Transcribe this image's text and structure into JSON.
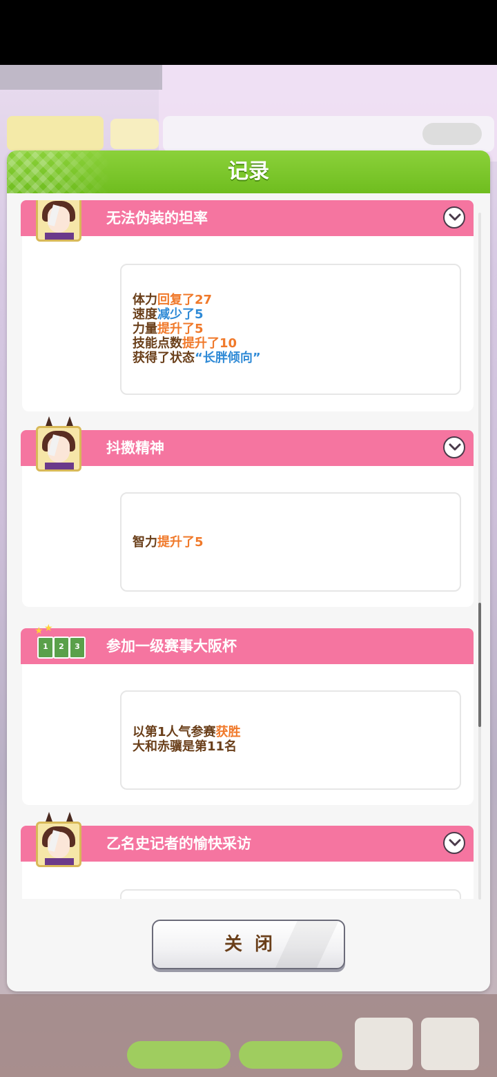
{
  "dialog": {
    "title": "记录"
  },
  "entries": [
    {
      "title": "无法伪装的坦率",
      "icon": "character-avatar",
      "lines": [
        {
          "parts": [
            {
              "text": "体力",
              "color": "brown"
            },
            {
              "text": "回复了27",
              "color": "orange"
            }
          ]
        },
        {
          "parts": [
            {
              "text": "速度",
              "color": "brown"
            },
            {
              "text": "减少了5",
              "color": "blue"
            }
          ]
        },
        {
          "parts": [
            {
              "text": "力量",
              "color": "brown"
            },
            {
              "text": "提升了5",
              "color": "orange"
            }
          ]
        },
        {
          "parts": [
            {
              "text": "技能点数",
              "color": "brown"
            },
            {
              "text": "提升了10",
              "color": "orange"
            }
          ]
        },
        {
          "parts": [
            {
              "text": "获得了状态",
              "color": "brown"
            },
            {
              "text": "“长胖倾向”",
              "color": "blue"
            }
          ]
        }
      ]
    },
    {
      "title": "抖擞精神",
      "icon": "character-avatar",
      "lines": [
        {
          "parts": [
            {
              "text": "智力",
              "color": "brown"
            },
            {
              "text": "提升了5",
              "color": "orange"
            }
          ]
        }
      ]
    },
    {
      "title": "参加一级赛事大阪杯",
      "icon": "race-ranking-icon",
      "icon_numbers": [
        "1",
        "2",
        "3"
      ],
      "lines": [
        {
          "parts": [
            {
              "text": "以第1人气参赛",
              "color": "brown"
            },
            {
              "text": "获胜",
              "color": "orange"
            }
          ]
        },
        {
          "parts": [
            {
              "text": "大和赤骥是第11名",
              "color": "brown"
            }
          ]
        }
      ]
    },
    {
      "title": "乙名史记者的愉快采访",
      "icon": "character-avatar",
      "lines": []
    }
  ],
  "footer": {
    "close_label": "关闭"
  },
  "colors": {
    "header_green": "#7cc52a",
    "entry_pink": "#f575a0",
    "text_brown": "#6a3f1a",
    "text_orange": "#f0792a",
    "text_blue": "#2f8ad6"
  }
}
